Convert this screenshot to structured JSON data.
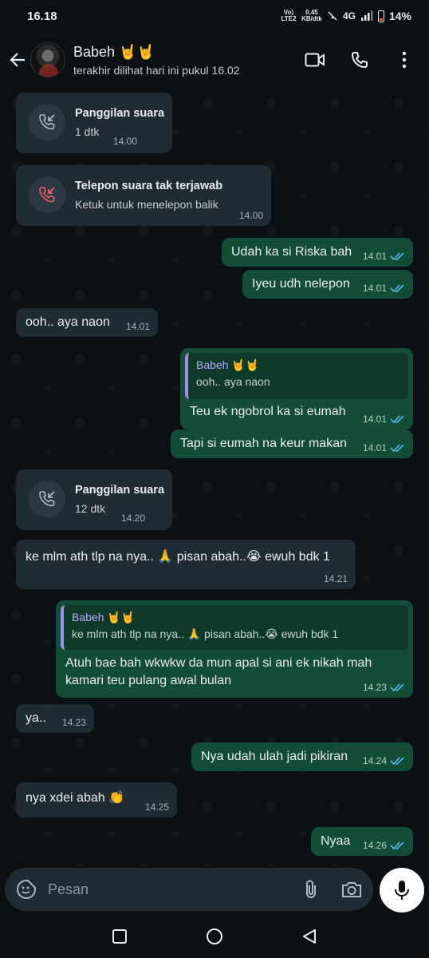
{
  "status_bar": {
    "time": "16.18",
    "volte": "Vo) LTE2",
    "speed": "0,45 KB/dtk",
    "network": "4G",
    "battery": "14%"
  },
  "header": {
    "contact_name": "Babeh 🤘🤘",
    "last_seen": "terakhir dilihat hari ini pukul 16.02",
    "icons": [
      "back-arrow-icon",
      "video-call-icon",
      "voice-call-icon",
      "more-options-icon"
    ]
  },
  "messages": [
    {
      "type": "call",
      "dir": "in",
      "title": "Panggilan suara",
      "subtitle": "1 dtk",
      "time": "14.00"
    },
    {
      "type": "call",
      "dir": "in",
      "title": "Telepon suara tak terjawab",
      "subtitle": "Ketuk untuk menelepon balik",
      "time": "14.00",
      "missed": true
    },
    {
      "type": "text",
      "dir": "out",
      "text": "Udah ka si Riska bah",
      "time": "14.01"
    },
    {
      "type": "text",
      "dir": "out",
      "text": "Iyeu udh nelepon",
      "time": "14.01"
    },
    {
      "type": "text",
      "dir": "in",
      "text": "ooh.. aya naon",
      "time": "14.01"
    },
    {
      "type": "reply",
      "dir": "out",
      "quote_name": "Babeh 🤘🤘",
      "quote_text": "ooh.. aya naon",
      "text": "Teu ek ngobrol ka si eumah",
      "time": "14.01"
    },
    {
      "type": "text",
      "dir": "out",
      "text": "Tapi si eumah na keur makan",
      "time": "14.01"
    },
    {
      "type": "call",
      "dir": "in",
      "title": "Panggilan suara",
      "subtitle": "12 dtk",
      "time": "14.20"
    },
    {
      "type": "text",
      "dir": "in",
      "text": "ke mlm ath tlp na nya.. 🙏 pisan abah..😭 ewuh bdk 1",
      "time": "14.21"
    },
    {
      "type": "reply",
      "dir": "out",
      "quote_name": "Babeh 🤘🤘",
      "quote_text": "ke mlm ath tlp na nya.. 🙏 pisan abah..😭 ewuh bdk 1",
      "text_line1": "Atuh bae bah wkwkw da mun apal si ani ek nikah mah",
      "text_line2": "kamari teu pulang awal bulan",
      "time": "14.23"
    },
    {
      "type": "text",
      "dir": "in",
      "text": "ya..",
      "time": "14.23"
    },
    {
      "type": "text",
      "dir": "out",
      "text": "Nya udah ulah jadi pikiran",
      "time": "14.24"
    },
    {
      "type": "text",
      "dir": "in",
      "text": "nya xdei abah 👏",
      "time": "14.25"
    },
    {
      "type": "text",
      "dir": "out",
      "text": "Nyaa",
      "time": "14.26"
    }
  ],
  "composer": {
    "placeholder": "Pesan",
    "icons": [
      "sticker-icon",
      "attach-icon",
      "camera-icon",
      "mic-icon"
    ]
  },
  "navbar": {
    "icons": [
      "recents-icon",
      "home-icon",
      "back-icon"
    ]
  },
  "colors": {
    "background": "#0b1014",
    "incoming_bubble": "#1f2c33",
    "outgoing_bubble": "#144d37",
    "read_ticks": "#53bdeb",
    "missed_call": "#f15c6d",
    "quote_bar": "#a08ee6"
  }
}
